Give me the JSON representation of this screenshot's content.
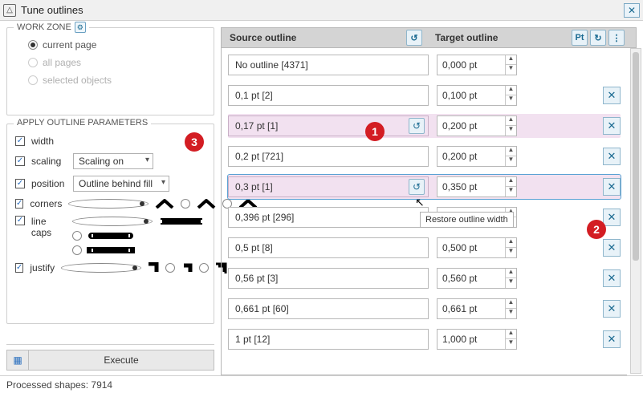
{
  "window": {
    "title": "Tune outlines"
  },
  "workzone": {
    "legend": "WORK ZONE",
    "options": {
      "current_page": "current page",
      "all_pages": "all pages",
      "selected_objects": "selected objects"
    },
    "selected": "current_page"
  },
  "apply": {
    "legend": "APPLY OUTLINE PARAMETERS",
    "width_label": "width",
    "scaling_label": "scaling",
    "scaling_value": "Scaling on",
    "position_label": "position",
    "position_value": "Outline behind fill",
    "corners_label": "corners",
    "linecaps_label": "line caps",
    "justify_label": "justify"
  },
  "execute_label": "Execute",
  "columns": {
    "source": "Source outline",
    "target": "Target outline"
  },
  "rows": [
    {
      "source": "No outline  [4371]",
      "target": "0,000 pt",
      "reset": false,
      "restore": false,
      "hl": false
    },
    {
      "source": "0,1 pt  [2]",
      "target": "0,100 pt",
      "reset": true,
      "restore": false,
      "hl": false
    },
    {
      "source": "0,17 pt  [1]",
      "target": "0,200 pt",
      "reset": true,
      "restore": true,
      "hl": true
    },
    {
      "source": "0,2 pt  [721]",
      "target": "0,200 pt",
      "reset": true,
      "restore": false,
      "hl": false
    },
    {
      "source": "0,3 pt  [1]",
      "target": "0,350 pt",
      "reset": true,
      "restore": true,
      "hl": true,
      "active": true
    },
    {
      "source": "0,396 pt  [296]",
      "target": "",
      "reset": true,
      "restore": false,
      "hl": false
    },
    {
      "source": "0,5 pt  [8]",
      "target": "0,500 pt",
      "reset": true,
      "restore": false,
      "hl": false
    },
    {
      "source": "0,56 pt  [3]",
      "target": "0,560 pt",
      "reset": true,
      "restore": false,
      "hl": false
    },
    {
      "source": "0,661 pt  [60]",
      "target": "0,661 pt",
      "reset": true,
      "restore": false,
      "hl": false
    },
    {
      "source": "1 pt  [12]",
      "target": "1,000 pt",
      "reset": true,
      "restore": false,
      "hl": false
    }
  ],
  "tooltip": "Restore outline width",
  "status": "Processed shapes: 7914",
  "badges": {
    "one": "1",
    "two": "2",
    "three": "3"
  }
}
